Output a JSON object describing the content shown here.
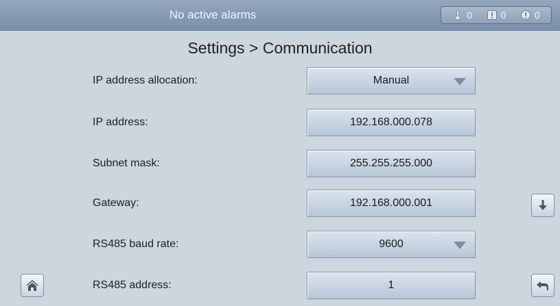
{
  "topbar": {
    "alarm_status": "No active alarms",
    "counts": {
      "minor": "0",
      "major": "0",
      "critical": "0"
    }
  },
  "page": {
    "title": "Settings > Communication"
  },
  "fields": [
    {
      "label": "IP address allocation:",
      "value": "Manual",
      "type": "dropdown"
    },
    {
      "label": "IP address:",
      "value": "192.168.000.078",
      "type": "input"
    },
    {
      "label": "Subnet mask:",
      "value": "255.255.255.000",
      "type": "input"
    },
    {
      "label": "Gateway:",
      "value": "192.168.000.001",
      "type": "input"
    },
    {
      "label": "RS485 baud rate:",
      "value": "9600",
      "type": "dropdown"
    },
    {
      "label": "RS485 address:",
      "value": "1",
      "type": "input"
    }
  ],
  "icons": {
    "scroll_down": "down-arrow-icon",
    "home": "home-icon",
    "back": "back-arrow-icon"
  }
}
